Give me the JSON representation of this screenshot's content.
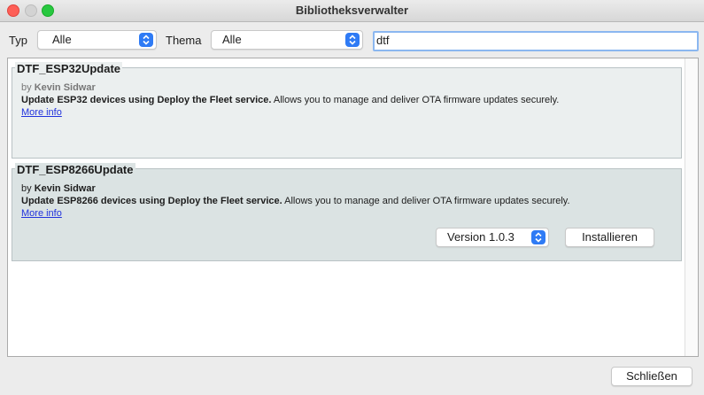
{
  "window": {
    "title": "Bibliotheksverwalter"
  },
  "filters": {
    "type_label": "Typ",
    "type_value": "Alle",
    "topic_label": "Thema",
    "topic_value": "Alle",
    "search_value": "dtf"
  },
  "libraries": [
    {
      "name": "DTF_ESP32Update",
      "by_prefix": "by",
      "author": "Kevin Sidwar",
      "desc_bold": "Update ESP32 devices using Deploy the Fleet service.",
      "desc_rest": " Allows you to manage and deliver OTA firmware updates securely.",
      "more_info": "More info"
    },
    {
      "name": "DTF_ESP8266Update",
      "by_prefix": "by",
      "author": "Kevin Sidwar",
      "desc_bold": "Update ESP8266 devices using Deploy the Fleet service.",
      "desc_rest": " Allows you to manage and deliver OTA firmware updates securely.",
      "more_info": "More info",
      "version": "Version 1.0.3",
      "install_label": "Installieren"
    }
  ],
  "footer": {
    "close_label": "Schließen"
  },
  "colors": {
    "accent": "#2f7bf5",
    "link": "#2233dd",
    "entry_bg": "#ebefef",
    "entry_selected_bg": "#dbe3e3"
  }
}
